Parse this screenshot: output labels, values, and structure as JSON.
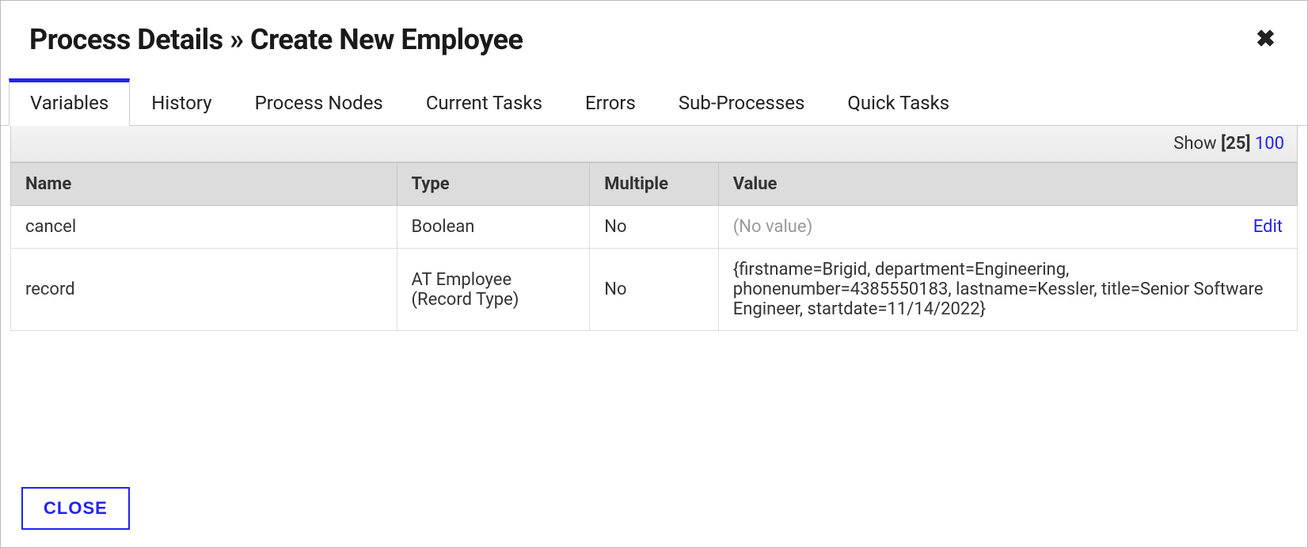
{
  "header": {
    "title": "Process Details » Create New Employee"
  },
  "tabs": [
    {
      "label": "Variables",
      "active": true
    },
    {
      "label": "History",
      "active": false
    },
    {
      "label": "Process Nodes",
      "active": false
    },
    {
      "label": "Current Tasks",
      "active": false
    },
    {
      "label": "Errors",
      "active": false
    },
    {
      "label": "Sub-Processes",
      "active": false
    },
    {
      "label": "Quick Tasks",
      "active": false
    }
  ],
  "pager": {
    "show_label": "Show",
    "current": "[25]",
    "other": "100"
  },
  "table": {
    "headers": {
      "name": "Name",
      "type": "Type",
      "multiple": "Multiple",
      "value": "Value"
    },
    "rows": [
      {
        "name": "cancel",
        "type": "Boolean",
        "multiple": "No",
        "value": "(No value)",
        "no_value": true,
        "editable": true
      },
      {
        "name": "record",
        "type": "AT Employee (Record Type)",
        "multiple": "No",
        "value": "{firstname=Brigid, department=Engineering, phonenumber=4385550183, lastname=Kessler, title=Senior Software Engineer, startdate=11/14/2022}",
        "no_value": false,
        "editable": false
      }
    ],
    "edit_label": "Edit"
  },
  "footer": {
    "close_label": "CLOSE"
  }
}
